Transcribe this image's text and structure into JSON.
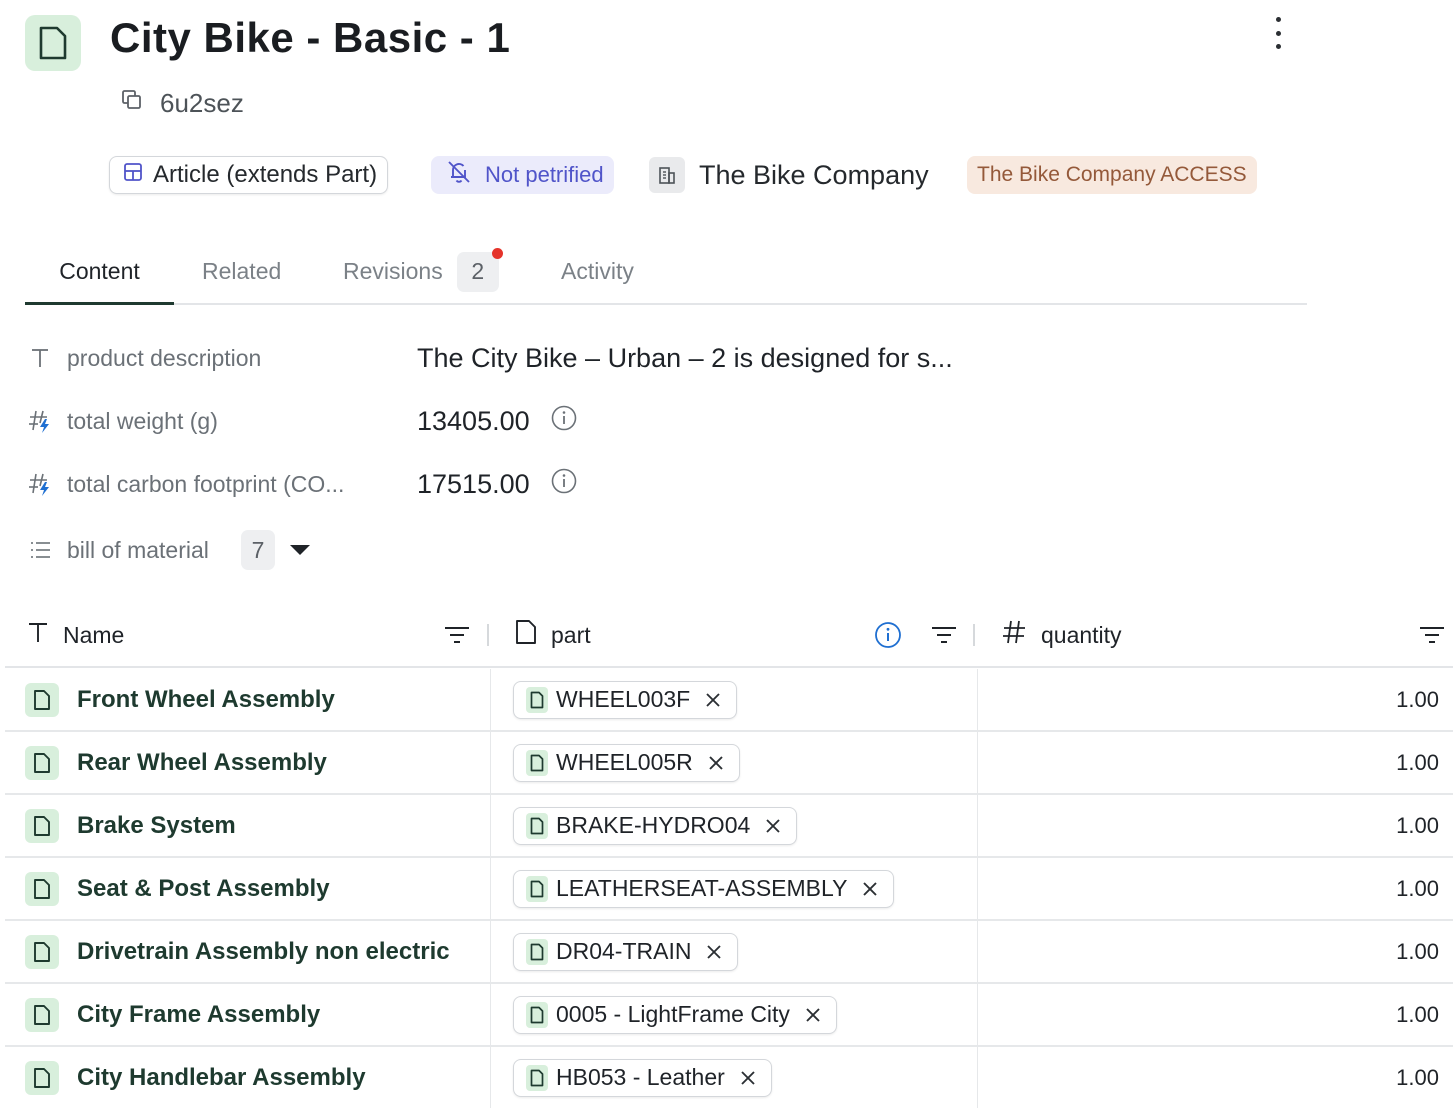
{
  "header": {
    "title": "City Bike - Basic - 1",
    "id": "6u2sez",
    "type_chip": "Article (extends Part)",
    "petrified_chip": "Not petrified",
    "company": "The Bike Company",
    "access_chip": "The Bike Company ACCESS"
  },
  "tabs": [
    {
      "label": "Content",
      "active": true
    },
    {
      "label": "Related"
    },
    {
      "label": "Revisions",
      "count": "2"
    },
    {
      "label": "Activity"
    }
  ],
  "properties": {
    "description": {
      "label": "product description",
      "value": "The City Bike – Urban – 2 is designed for s..."
    },
    "weight": {
      "label": "total weight (g)",
      "value": "13405.00"
    },
    "carbon": {
      "label": "total carbon footprint (CO...",
      "value": "17515.00"
    },
    "bom": {
      "label": "bill of material",
      "count": "7"
    }
  },
  "table": {
    "columns": {
      "name": "Name",
      "part": "part",
      "quantity": "quantity"
    },
    "rows": [
      {
        "name": "Front Wheel Assembly",
        "part": "WHEEL003F",
        "quantity": "1.00"
      },
      {
        "name": "Rear Wheel Assembly",
        "part": "WHEEL005R",
        "quantity": "1.00"
      },
      {
        "name": "Brake System",
        "part": "BRAKE-HYDRO04",
        "quantity": "1.00"
      },
      {
        "name": "Seat & Post Assembly",
        "part": "LEATHERSEAT-ASSEMBLY",
        "quantity": "1.00"
      },
      {
        "name": "Drivetrain Assembly non electric",
        "part": "DR04-TRAIN",
        "quantity": "1.00"
      },
      {
        "name": "City Frame Assembly",
        "part": "0005 - LightFrame City",
        "quantity": "1.00"
      },
      {
        "name": "City Handlebar Assembly",
        "part": "HB053 - Leather",
        "quantity": "1.00"
      }
    ]
  },
  "colors": {
    "doc_icon_bg": "#d8efdc",
    "doc_icon_stroke": "#1e3a2f",
    "petrified_bg": "#ebebfb",
    "petrified_fg": "#5054c9",
    "access_bg": "#f8e9df",
    "access_fg": "#94593a",
    "info_blue": "#1f6fd1",
    "notify_red": "#e5332a"
  }
}
